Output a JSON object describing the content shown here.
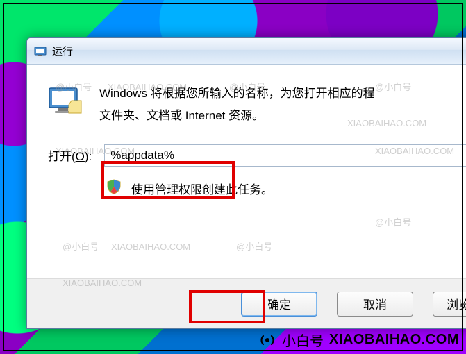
{
  "window": {
    "title": "运行"
  },
  "description": {
    "line1": "Windows 将根据您所输入的名称，为您打开相应的程",
    "line2": "文件夹、文档或 Internet 资源。"
  },
  "open": {
    "label_prefix": "打开(",
    "label_hotkey": "O",
    "label_suffix": "):",
    "value": "%appdata%"
  },
  "shield": {
    "text": "使用管理权限创建此任务。"
  },
  "buttons": {
    "ok": "确定",
    "cancel": "取消",
    "browse": "浏览("
  },
  "watermark": {
    "cn": "@小白号",
    "en": "XIAOBAIHAO.COM"
  },
  "footer": {
    "cn": "小白号",
    "en": "XIAOBAIHAO.COM"
  }
}
